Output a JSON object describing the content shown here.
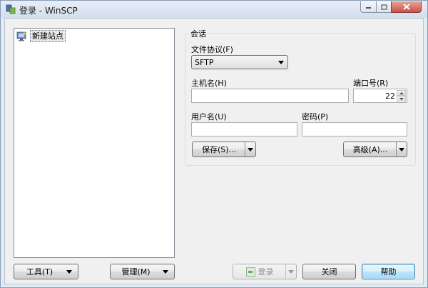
{
  "window": {
    "title": "登录 - WinSCP"
  },
  "sites": {
    "items": [
      {
        "label": "新建站点",
        "icon": "new-site-monitor-icon"
      }
    ]
  },
  "session": {
    "group_title": "会话",
    "protocol_label": "文件协议(F)",
    "protocol_value": "SFTP",
    "host_label": "主机名(H)",
    "host_value": "",
    "port_label": "端口号(R)",
    "port_value": "22",
    "user_label": "用户名(U)",
    "user_value": "",
    "password_label": "密码(P)",
    "password_value": "",
    "save_label": "保存(S)...",
    "advanced_label": "高级(A)..."
  },
  "footer": {
    "tools_label": "工具(T)",
    "manage_label": "管理(M)",
    "login_label": "登录",
    "close_label": "关闭",
    "help_label": "帮助"
  },
  "colors": {
    "title_bar": "#dbe5f1",
    "close_button": "#c75050",
    "default_button_border": "#3c7fb1"
  }
}
